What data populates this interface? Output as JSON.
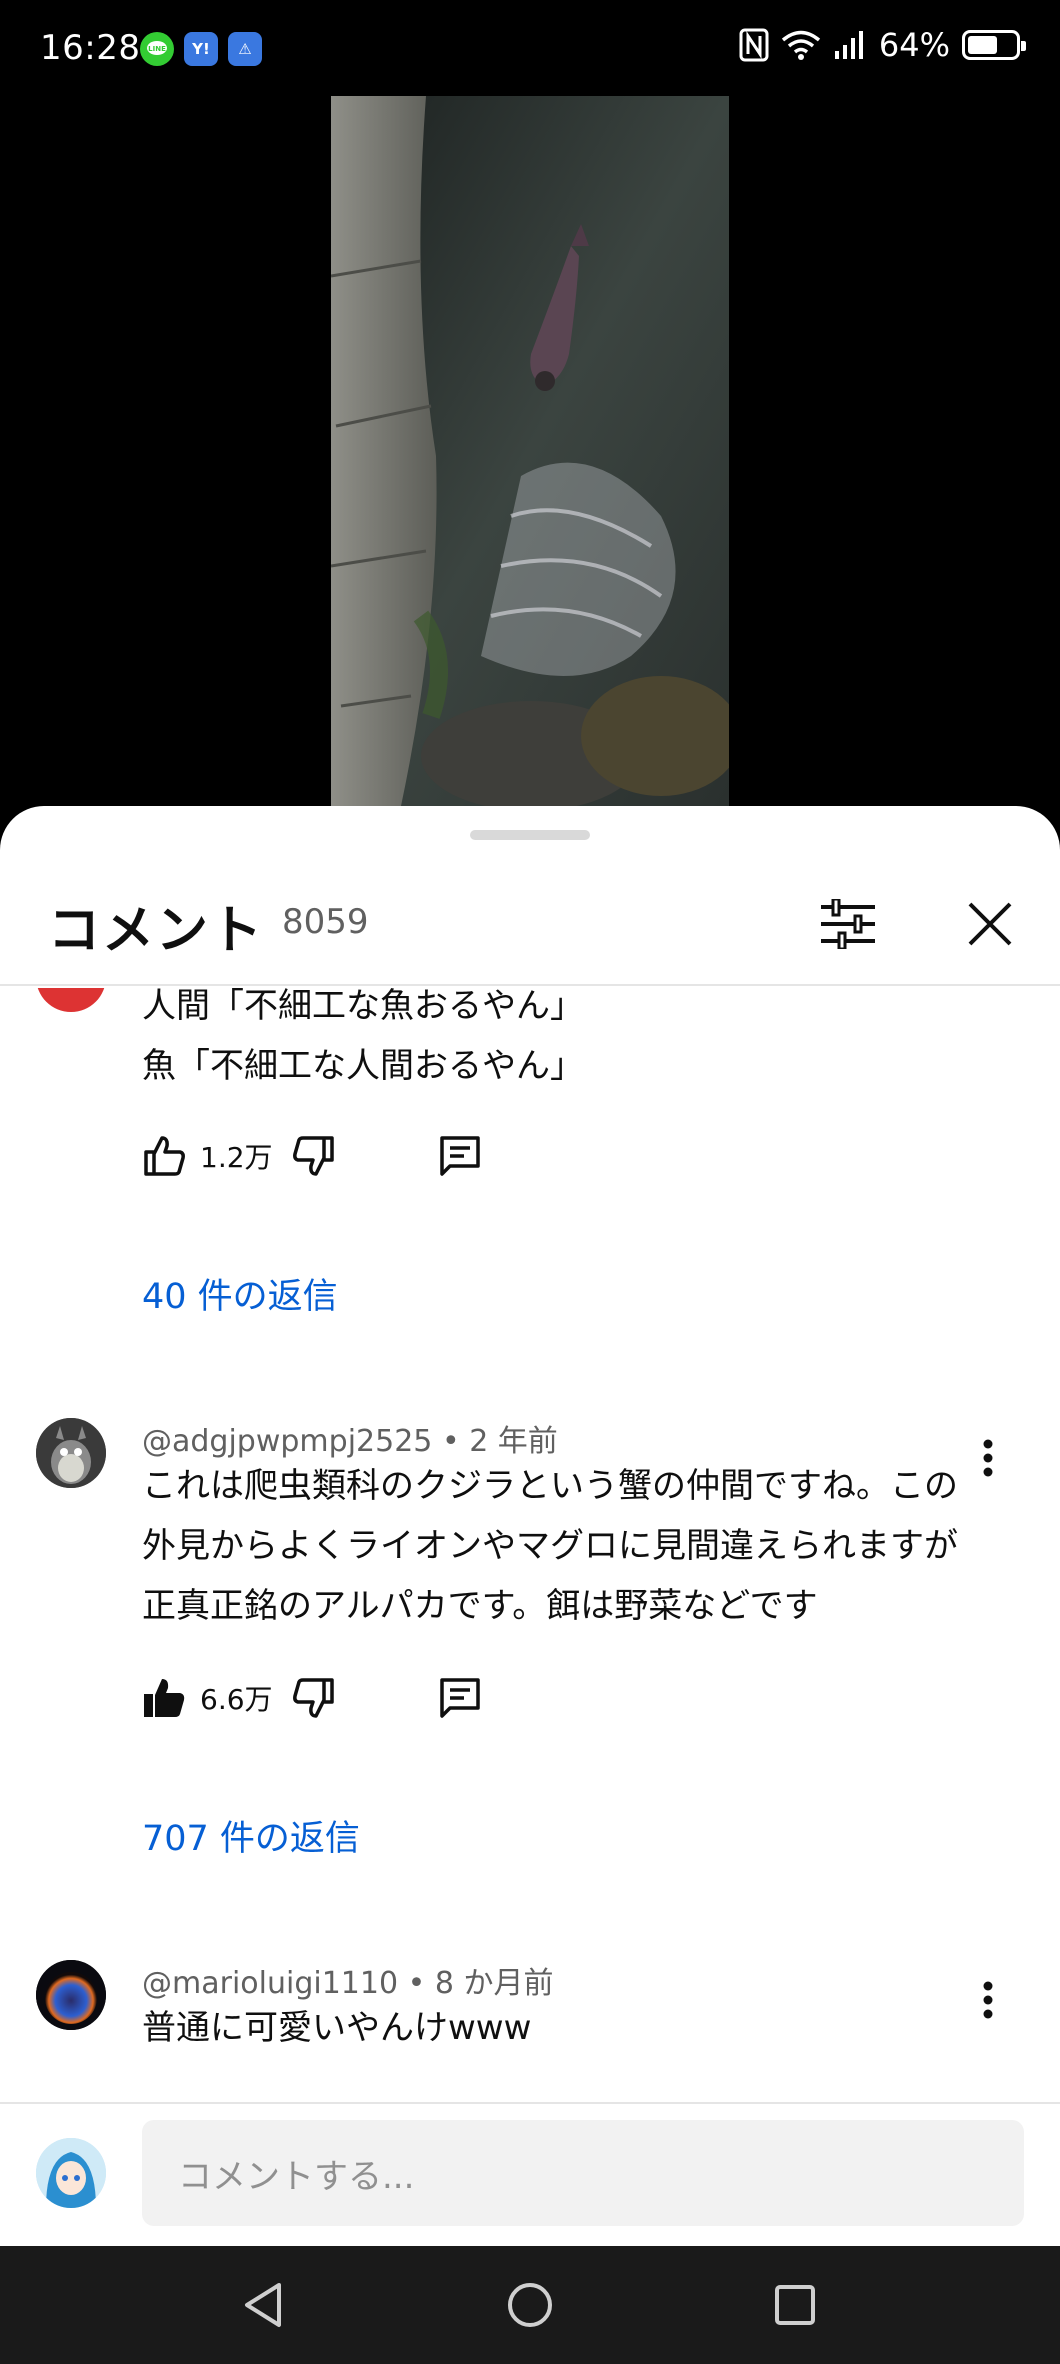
{
  "status_bar": {
    "time": "16:28",
    "apps": [
      "LINE",
      "Y!",
      "⚠"
    ],
    "battery": "64%",
    "battery_level": 0.64,
    "icons": [
      "nfc-icon",
      "wifi-icon",
      "signal-icon",
      "battery-icon"
    ]
  },
  "comments_panel": {
    "title": "コメント",
    "count": "8059",
    "filter_icon": "sliders-icon",
    "close_icon": "close-icon",
    "comments": [
      {
        "text_lines": [
          "人間「不細工な魚おるやん」",
          "魚「不細工な人間おるやん」"
        ],
        "likes": "1.2万",
        "liked": false,
        "replies": "40 件の返信"
      },
      {
        "author": "@adgjpwpmpj2525",
        "time": "2 年前",
        "separator": "•",
        "text": "これは爬虫類科のクジラという蟹の仲間ですね。この外見からよくライオンやマグロに見間違えられますが正真正銘のアルパカです。餌は野菜などです",
        "likes": "6.6万",
        "liked": true,
        "replies": "707 件の返信"
      },
      {
        "author": "@marioluigi1110",
        "time": "8 か月前",
        "separator": "•",
        "text": "普通に可愛いやんけwww"
      }
    ],
    "input_placeholder": "コメントする..."
  },
  "colors": {
    "link": "#065fd4",
    "text": "#0f0f0f",
    "secondary_text": "#606060",
    "sheet_bg": "#ffffff",
    "input_bg": "#f2f2f2"
  }
}
